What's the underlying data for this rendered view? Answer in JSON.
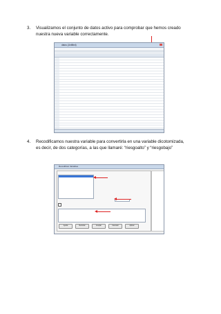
{
  "step3": {
    "number": "3.",
    "line1": "Visualizamos el conjunto de datos activo para comprobar que hemos creado",
    "line2": "nuestra nueva variable correctamente."
  },
  "step4": {
    "number": "4.",
    "line1": "Recodificamos nuestra variable para convertirla en una variable dicotomizada,",
    "line2": "es decir, de dos categorías, a las que llamaré: “riesgoalto” y “riesgobajo”"
  },
  "screenshot1": {
    "title": "datos (Untitled)"
  },
  "screenshot2": {
    "title": "Recodificar Variables",
    "buttons": [
      "Ayuda",
      "Reiniciar",
      "Aceptar",
      "Cancelar",
      "Aplicar"
    ]
  },
  "colors": {
    "annotation": "#d22222",
    "selection": "#3875d7"
  }
}
